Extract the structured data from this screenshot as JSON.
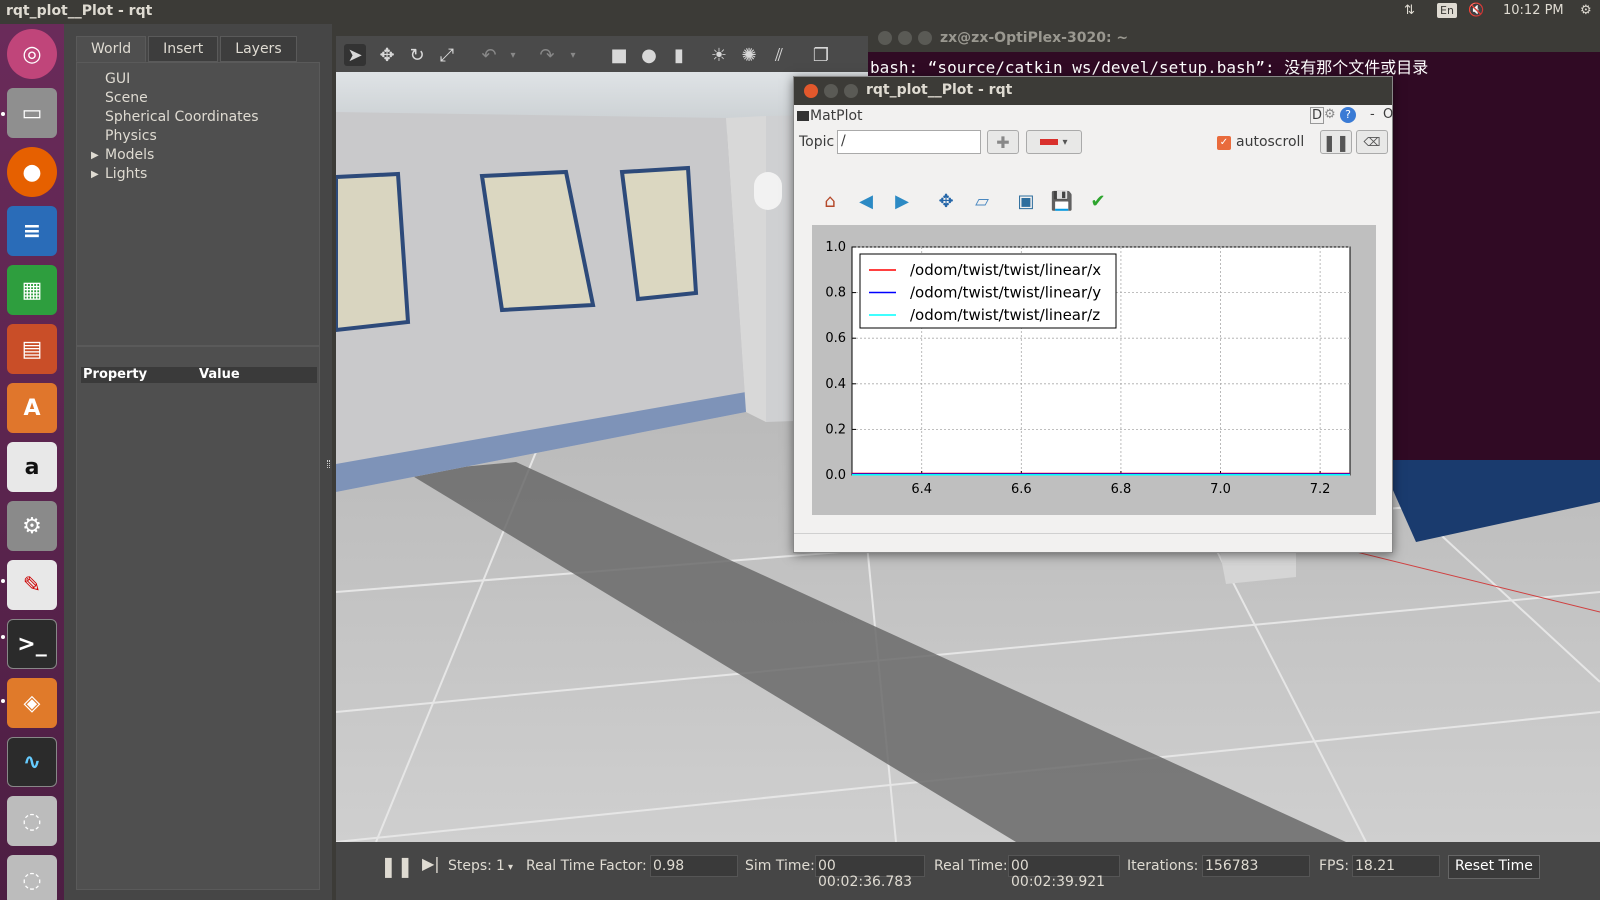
{
  "topbar": {
    "title": "rqt_plot__Plot - rqt",
    "lang": "En",
    "time": "10:12 PM"
  },
  "launcher": {
    "tooltip": "终端"
  },
  "gazebo": {
    "tabs": [
      "World",
      "Insert",
      "Layers"
    ],
    "tree": [
      {
        "label": "GUI",
        "expandable": false
      },
      {
        "label": "Scene",
        "expandable": false
      },
      {
        "label": "Spherical Coordinates",
        "expandable": false
      },
      {
        "label": "Physics",
        "expandable": false
      },
      {
        "label": "Models",
        "expandable": true
      },
      {
        "label": "Lights",
        "expandable": true
      }
    ],
    "property_header": "Property",
    "value_header": "Value",
    "bottom": {
      "steps_label": "Steps:",
      "steps_value": "1",
      "rtf_label": "Real Time Factor:",
      "rtf_value": "0.98",
      "sim_label": "Sim Time:",
      "sim_value": "00 00:02:36.783",
      "real_label": "Real Time:",
      "real_value": "00 00:02:39.921",
      "iter_label": "Iterations:",
      "iter_value": "156783",
      "fps_label": "FPS:",
      "fps_value": "18.21",
      "reset_label": "Reset Time"
    }
  },
  "terminal": {
    "title": "zx@zx-OptiPlex-3020: ~",
    "line1": "bash: “source/catkin_ws/devel/setup.bash”: 没有那个文件或目录"
  },
  "rqt": {
    "title": "rqt_plot__Plot - rqt",
    "plugin": "MatPlot",
    "plugin_ctrl": "D",
    "plugin_min": "-",
    "plugin_close": "O",
    "topic_label": "Topic",
    "topic_value": "/",
    "autoscroll_label": "autoscroll",
    "autoscroll_checked": true
  },
  "chart_data": {
    "type": "line",
    "title": "",
    "xlabel": "",
    "ylabel": "",
    "xlim": [
      6.26,
      7.26
    ],
    "ylim": [
      0.0,
      1.0
    ],
    "xticks": [
      "6.4",
      "6.6",
      "6.8",
      "7.0",
      "7.2"
    ],
    "xtick_values": [
      6.4,
      6.6,
      6.8,
      7.0,
      7.2
    ],
    "yticks": [
      "0.0",
      "0.2",
      "0.4",
      "0.6",
      "0.8",
      "1.0"
    ],
    "ytick_values": [
      0.0,
      0.2,
      0.4,
      0.6,
      0.8,
      1.0
    ],
    "grid": true,
    "legend_position": "top-left",
    "series": [
      {
        "name": "/odom/twist/twist/linear/x",
        "color": "#ff0000",
        "x": [
          6.26,
          7.26
        ],
        "y": [
          0.0,
          0.0
        ]
      },
      {
        "name": "/odom/twist/twist/linear/y",
        "color": "#0000ff",
        "x": [
          6.26,
          7.26
        ],
        "y": [
          0.0,
          0.0
        ]
      },
      {
        "name": "/odom/twist/twist/linear/z",
        "color": "#00ffff",
        "x": [
          6.26,
          7.26
        ],
        "y": [
          0.0,
          0.0
        ]
      }
    ]
  }
}
